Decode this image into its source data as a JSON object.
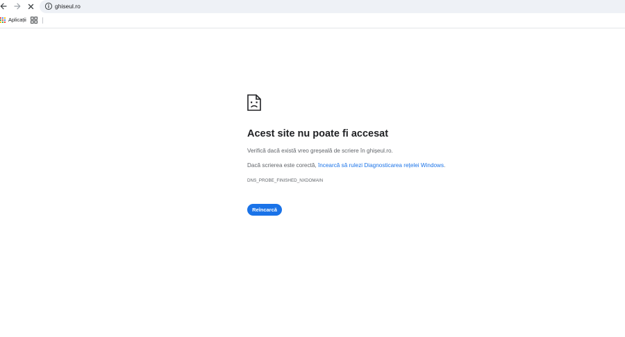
{
  "browser": {
    "url": "ghiseul.ro",
    "bookmarks": {
      "apps_label": "Aplicații"
    }
  },
  "error_page": {
    "title": "Acest site nu poate fi accesat",
    "line1": "Verifică dacă există vreo greșeală de scriere în ghișeul.ro.",
    "line2_prefix": "Dacă scrierea este corectă, ",
    "line2_link": "încearcă să rulezi Diagnosticarea rețelei Windows",
    "line2_suffix": ".",
    "error_code": "DNS_PROBE_FINISHED_NXDOMAIN",
    "reload_label": "Reîncarcă"
  },
  "colors": {
    "accent": "#1a73e8",
    "omnibox_bg": "#eef1f6"
  }
}
